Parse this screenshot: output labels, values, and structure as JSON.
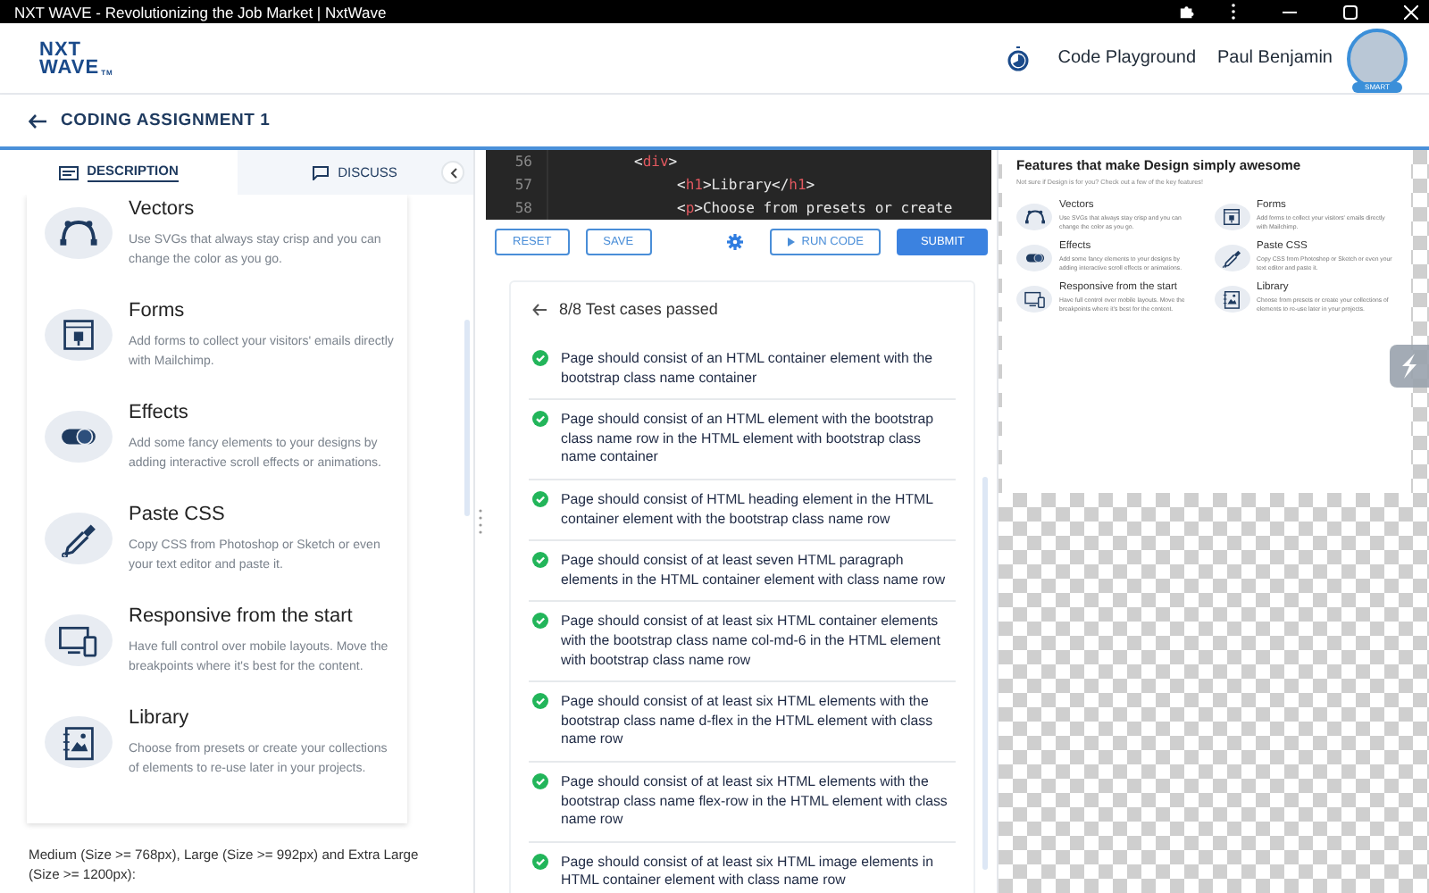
{
  "window": {
    "title": "NXT WAVE - Revolutionizing the Job Market | NxtWave"
  },
  "header": {
    "logo": [
      "NXT",
      "WAVE"
    ],
    "logo_mark": "TM",
    "nav_link": "Code Playground",
    "user_name": "Paul Benjamin",
    "avatar_badge": "SMART"
  },
  "assignment": {
    "title": "CODING ASSIGNMENT 1"
  },
  "left_panel": {
    "tabs": [
      {
        "label": "DESCRIPTION",
        "kind": "description",
        "selected": true
      },
      {
        "label": "DISCUSS",
        "kind": "chat",
        "selected": false
      }
    ],
    "features": [
      {
        "kind": "vector",
        "title": "Vectors",
        "description": "Use SVGs that always stay crisp and you can change the color as you go."
      },
      {
        "kind": "form",
        "title": "Forms",
        "description": "Add forms to collect your visitors' emails directly with Mailchimp."
      },
      {
        "kind": "effects",
        "title": "Effects",
        "description": "Add some fancy elements to your designs by adding interactive scroll effects or animations."
      },
      {
        "kind": "dropper",
        "title": "Paste CSS",
        "description": "Copy CSS from Photoshop or Sketch or even your text editor and paste it."
      },
      {
        "kind": "responsive",
        "title": "Responsive from the start",
        "description": "Have full control over mobile layouts. Move the breakpoints where it's best for the content."
      },
      {
        "kind": "library",
        "title": "Library",
        "description": "Choose from presets or create your collections of elements to re-use later in your projects."
      }
    ],
    "note": "Medium (Size >= 768px), Large (Size >= 992px) and Extra Large (Size >= 1200px):"
  },
  "editor": {
    "lines": [
      {
        "number": "56",
        "tokens": [
          {
            "kind": "punct",
            "text": "<"
          },
          {
            "kind": "tag",
            "text": "div"
          },
          {
            "kind": "punct",
            "text": ">"
          }
        ]
      },
      {
        "number": "57",
        "tokens": [
          {
            "kind": "punct",
            "text": "<"
          },
          {
            "kind": "tag",
            "text": "h1"
          },
          {
            "kind": "punct",
            "text": ">"
          },
          {
            "kind": "text",
            "text": "Library"
          },
          {
            "kind": "punct",
            "text": "</"
          },
          {
            "kind": "tag",
            "text": "h1"
          },
          {
            "kind": "punct",
            "text": ">"
          }
        ]
      },
      {
        "number": "58",
        "tokens": [
          {
            "kind": "punct",
            "text": "<"
          },
          {
            "kind": "tag",
            "text": "p"
          },
          {
            "kind": "punct",
            "text": ">"
          },
          {
            "kind": "text",
            "text": "Choose from presets or create"
          }
        ]
      }
    ]
  },
  "actions": [
    {
      "kind": "outline",
      "label": "RESET"
    },
    {
      "kind": "outline",
      "label": "SAVE"
    },
    {
      "kind": "settings"
    },
    {
      "kind": "run",
      "label": "RUN CODE"
    },
    {
      "kind": "primary",
      "label": "SUBMIT"
    }
  ],
  "tests": {
    "summary": "8/8 Test cases passed",
    "cases": [
      {
        "passed": true,
        "text": "Page should consist of an HTML container element with the bootstrap class name container"
      },
      {
        "passed": true,
        "text": "Page should consist of an HTML element with the bootstrap class name row in the HTML element with bootstrap class name container"
      },
      {
        "passed": true,
        "text": "Page should consist of HTML heading element in the HTML container element with the bootstrap class name row"
      },
      {
        "passed": true,
        "text": "Page should consist of at least seven HTML paragraph elements in the HTML container element with class name row"
      },
      {
        "passed": true,
        "text": "Page should consist of at least six HTML container elements with the bootstrap class name col-md-6 in the HTML element with bootstrap class name row"
      },
      {
        "passed": true,
        "text": "Page should consist of at least six HTML elements with the bootstrap class name d-flex in the HTML element with class name row"
      },
      {
        "passed": true,
        "text": "Page should consist of at least six HTML elements with the bootstrap class name flex-row in the HTML element with class name row"
      },
      {
        "passed": true,
        "text": "Page should consist of at least six HTML image elements in HTML container element with class name row"
      }
    ]
  },
  "preview": {
    "heading": "Features that make Design simply awesome",
    "subtitle": "Not sure if Design is for you? Check out a few of the key features!",
    "features": [
      {
        "kind": "vector",
        "title": "Vectors",
        "description": "Use SVGs that always stay crisp and you can change the color as you go."
      },
      {
        "kind": "form",
        "title": "Forms",
        "description": "Add forms to collect your visitors' emails directly with Mailchimp."
      },
      {
        "kind": "effects",
        "title": "Effects",
        "description": "Add some fancy elements to your designs by adding interactive scroll effects or animations."
      },
      {
        "kind": "dropper",
        "title": "Paste CSS",
        "description": "Copy CSS from Photoshop or Sketch or even your text editor and paste it."
      },
      {
        "kind": "responsive",
        "title": "Responsive from the start",
        "description": "Have full control over mobile layouts. Move the breakpoints where it's best for the content."
      },
      {
        "kind": "library",
        "title": "Library",
        "description": "Choose from presets or create your collections of elements to re-use later in your projects."
      }
    ]
  }
}
